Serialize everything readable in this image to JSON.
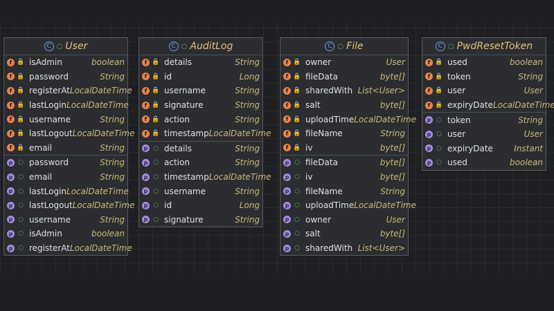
{
  "classes": [
    {
      "name": "User",
      "fields": [
        {
          "name": "isAdmin",
          "type": "boolean"
        },
        {
          "name": "password",
          "type": "String"
        },
        {
          "name": "registerAt",
          "type": "LocalDateTime"
        },
        {
          "name": "lastLogin",
          "type": "LocalDateTime"
        },
        {
          "name": "username",
          "type": "String"
        },
        {
          "name": "lastLogout",
          "type": "LocalDateTime"
        },
        {
          "name": "email",
          "type": "String"
        }
      ],
      "properties": [
        {
          "name": "password",
          "type": "String"
        },
        {
          "name": "email",
          "type": "String"
        },
        {
          "name": "lastLogin",
          "type": "LocalDateTime"
        },
        {
          "name": "lastLogout",
          "type": "LocalDateTime"
        },
        {
          "name": "username",
          "type": "String"
        },
        {
          "name": "isAdmin",
          "type": "boolean"
        },
        {
          "name": "registerAt",
          "type": "LocalDateTime"
        }
      ]
    },
    {
      "name": "AuditLog",
      "fields": [
        {
          "name": "details",
          "type": "String"
        },
        {
          "name": "id",
          "type": "Long"
        },
        {
          "name": "username",
          "type": "String"
        },
        {
          "name": "signature",
          "type": "String"
        },
        {
          "name": "action",
          "type": "String"
        },
        {
          "name": "timestamp",
          "type": "LocalDateTime"
        }
      ],
      "properties": [
        {
          "name": "details",
          "type": "String"
        },
        {
          "name": "action",
          "type": "String"
        },
        {
          "name": "timestamp",
          "type": "LocalDateTime"
        },
        {
          "name": "username",
          "type": "String"
        },
        {
          "name": "id",
          "type": "Long"
        },
        {
          "name": "signature",
          "type": "String"
        }
      ]
    },
    {
      "name": "File",
      "fields": [
        {
          "name": "owner",
          "type": "User"
        },
        {
          "name": "fileData",
          "type": "byte[]"
        },
        {
          "name": "sharedWith",
          "type": "List<User>"
        },
        {
          "name": "salt",
          "type": "byte[]"
        },
        {
          "name": "uploadTime",
          "type": "LocalDateTime"
        },
        {
          "name": "fileName",
          "type": "String"
        },
        {
          "name": "iv",
          "type": "byte[]"
        }
      ],
      "properties": [
        {
          "name": "fileData",
          "type": "byte[]"
        },
        {
          "name": "iv",
          "type": "byte[]"
        },
        {
          "name": "fileName",
          "type": "String"
        },
        {
          "name": "uploadTime",
          "type": "LocalDateTime"
        },
        {
          "name": "owner",
          "type": "User"
        },
        {
          "name": "salt",
          "type": "byte[]"
        },
        {
          "name": "sharedWith",
          "type": "List<User>"
        }
      ]
    },
    {
      "name": "PwdResetToken",
      "fields": [
        {
          "name": "used",
          "type": "boolean"
        },
        {
          "name": "token",
          "type": "String"
        },
        {
          "name": "user",
          "type": "User"
        },
        {
          "name": "expiryDate",
          "type": "LocalDateTime"
        }
      ],
      "properties": [
        {
          "name": "token",
          "type": "String"
        },
        {
          "name": "user",
          "type": "User"
        },
        {
          "name": "expiryDate",
          "type": "Instant"
        },
        {
          "name": "used",
          "type": "boolean"
        }
      ]
    }
  ],
  "icons": {
    "class": "class-c-icon",
    "public": "public-circle-icon",
    "field": "field-f-icon",
    "property": "property-p-icon",
    "private": "lock-icon"
  },
  "colors": {
    "background": "#1e1f22",
    "node": "#2b2d30",
    "field_badge": "#e8834c",
    "property_badge": "#a58ae6",
    "type": "#c8b97a",
    "title": "#e6c07b"
  }
}
